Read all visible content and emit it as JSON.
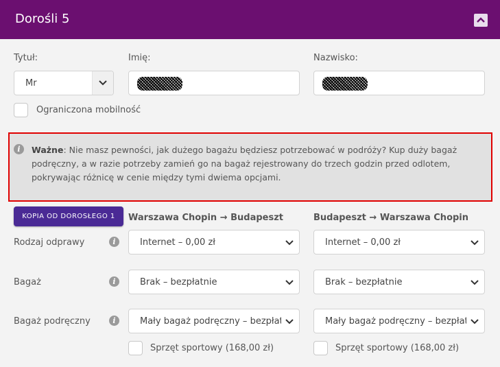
{
  "header": {
    "title": "Dorośli 5"
  },
  "form": {
    "title_label": "Tytuł:",
    "title_value": "Mr",
    "first_name_label": "Imię:",
    "last_name_label": "Nazwisko:",
    "reduced_mobility_label": "Ograniczona mobilność"
  },
  "notice": {
    "bold": "Ważne",
    "text": ": Nie masz pewności, jak dużego bagażu będziesz potrzebować w podróży? Kup duży bagaż podręczny, a w razie potrzeby zamień go na bagaż rejestrowany do trzech godzin przed odlotem, pokrywając różnicę w cenie między tymi dwiema opcjami."
  },
  "copy_button": "KOPIA OD DOROSŁEGO 1",
  "routes": {
    "outbound": "Warszawa Chopin → Budapeszt",
    "return": "Budapeszt → Warszawa Chopin"
  },
  "rows": {
    "checkin_label": "Rodzaj odprawy",
    "baggage_label": "Bagaż",
    "cabin_label": "Bagaż podręczny"
  },
  "outbound": {
    "checkin": "Internet – 0,00 zł",
    "baggage": "Brak – bezpłatnie",
    "cabin": "Mały bagaż podręczny – bezpłatnie",
    "sport": "Sprzęt sportowy (168,00 zł)"
  },
  "return": {
    "checkin": "Internet – 0,00 zł",
    "baggage": "Brak – bezpłatnie",
    "cabin": "Mały bagaż podręczny – bezpłatnie",
    "sport": "Sprzęt sportowy (168,00 zł)"
  },
  "icons": {
    "collapse": "chevron-up-icon",
    "dropdown": "chevron-down-icon",
    "info": "info-icon"
  },
  "colors": {
    "header_bg": "#6b0f70",
    "button_bg": "#4a2a95",
    "notice_border": "#e00000"
  }
}
